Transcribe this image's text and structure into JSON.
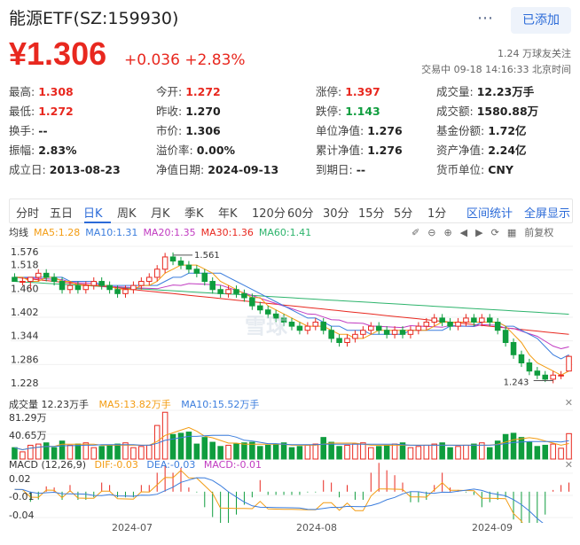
{
  "header": {
    "title": "能源ETF(SZ:159930)",
    "add_label": "已添加",
    "more_icon": "more-icon"
  },
  "quote": {
    "price": "¥1.306",
    "change": "+0.036 +2.83%",
    "followers": "1.24 万球友关注",
    "status": "交易中 09-18 14:16:33 北京时间"
  },
  "stats": [
    {
      "k": "最高:",
      "v": "1.308",
      "c": "red"
    },
    {
      "k": "今开:",
      "v": "1.272",
      "c": "red"
    },
    {
      "k": "涨停:",
      "v": "1.397",
      "c": "red"
    },
    {
      "k": "成交量:",
      "v": "12.23万手",
      "c": ""
    },
    {
      "k": "最低:",
      "v": "1.272",
      "c": "red"
    },
    {
      "k": "昨收:",
      "v": "1.270",
      "c": ""
    },
    {
      "k": "跌停:",
      "v": "1.143",
      "c": "green"
    },
    {
      "k": "成交额:",
      "v": "1580.88万",
      "c": ""
    },
    {
      "k": "换手:",
      "v": "--",
      "c": ""
    },
    {
      "k": "市价:",
      "v": "1.306",
      "c": ""
    },
    {
      "k": "单位净值:",
      "v": "1.276",
      "c": ""
    },
    {
      "k": "基金份额:",
      "v": "1.72亿",
      "c": ""
    },
    {
      "k": "振幅:",
      "v": "2.83%",
      "c": ""
    },
    {
      "k": "溢价率:",
      "v": "0.00%",
      "c": ""
    },
    {
      "k": "累计净值:",
      "v": "1.276",
      "c": ""
    },
    {
      "k": "资产净值:",
      "v": "2.24亿",
      "c": ""
    },
    {
      "k": "成立日:",
      "v": "2013-08-23",
      "c": ""
    },
    {
      "k": "净值日期:",
      "v": "2024-09-13",
      "c": ""
    },
    {
      "k": "到期日:",
      "v": "--",
      "c": ""
    },
    {
      "k": "货币单位:",
      "v": "CNY",
      "c": ""
    }
  ],
  "tabs": [
    "分时",
    "五日",
    "日K",
    "周K",
    "月K",
    "季K",
    "年K",
    "120分",
    "60分",
    "30分",
    "15分",
    "5分",
    "1分"
  ],
  "active_tab": "日K",
  "tabs_right": [
    "区间统计",
    "全屏显示"
  ],
  "ma_legend": [
    {
      "label": "均线",
      "color": "#333333"
    },
    {
      "label": "MA5:1.28",
      "color": "#f39c12"
    },
    {
      "label": "MA10:1.31",
      "color": "#3b7ddd"
    },
    {
      "label": "MA20:1.35",
      "color": "#c13bc1"
    },
    {
      "label": "MA30:1.36",
      "color": "#e8281f"
    },
    {
      "label": "MA60:1.41",
      "color": "#2db46c"
    }
  ],
  "adjust_label": "前复权",
  "price_axis": [
    "1.576",
    "1.518",
    "1.460",
    "1.402",
    "1.344",
    "1.286",
    "1.228"
  ],
  "annotations": {
    "high": "1.561",
    "low": "1.243"
  },
  "watermark": "雪球",
  "volume": {
    "title": "成交量 12.23万手",
    "ma5": "MA5:13.82万手",
    "ma10": "MA10:15.52万手",
    "axis_top": "81.29万",
    "axis_mid": "40.65万"
  },
  "macd": {
    "title": "MACD (12,26,9)",
    "dif": "DIF:-0.03",
    "dea": "DEA:-0.03",
    "macd": "MACD:-0.01",
    "axis": [
      "0.02",
      "-0.01",
      "-0.04"
    ]
  },
  "dates": [
    "2024-07",
    "2024-08",
    "2024-09"
  ],
  "colors": {
    "up": "#e8281f",
    "down": "#0f9d3e",
    "accent": "#2c6bd8"
  },
  "chart_data": {
    "type": "candlestick",
    "ylim": [
      1.228,
      1.576
    ],
    "ohlc": [
      [
        1.5,
        1.51,
        1.49,
        1.49
      ],
      [
        1.49,
        1.5,
        1.48,
        1.49
      ],
      [
        1.49,
        1.5,
        1.47,
        1.5
      ],
      [
        1.5,
        1.52,
        1.49,
        1.51
      ],
      [
        1.51,
        1.52,
        1.49,
        1.5
      ],
      [
        1.5,
        1.51,
        1.48,
        1.49
      ],
      [
        1.49,
        1.5,
        1.46,
        1.47
      ],
      [
        1.47,
        1.49,
        1.46,
        1.48
      ],
      [
        1.48,
        1.49,
        1.46,
        1.47
      ],
      [
        1.47,
        1.49,
        1.46,
        1.48
      ],
      [
        1.48,
        1.5,
        1.47,
        1.49
      ],
      [
        1.49,
        1.5,
        1.47,
        1.48
      ],
      [
        1.48,
        1.49,
        1.46,
        1.47
      ],
      [
        1.47,
        1.48,
        1.45,
        1.46
      ],
      [
        1.46,
        1.48,
        1.45,
        1.47
      ],
      [
        1.47,
        1.49,
        1.46,
        1.48
      ],
      [
        1.48,
        1.5,
        1.47,
        1.49
      ],
      [
        1.49,
        1.51,
        1.48,
        1.5
      ],
      [
        1.5,
        1.53,
        1.49,
        1.52
      ],
      [
        1.52,
        1.56,
        1.51,
        1.55
      ],
      [
        1.55,
        1.561,
        1.53,
        1.54
      ],
      [
        1.54,
        1.55,
        1.52,
        1.53
      ],
      [
        1.53,
        1.54,
        1.51,
        1.52
      ],
      [
        1.52,
        1.53,
        1.5,
        1.51
      ],
      [
        1.51,
        1.52,
        1.48,
        1.49
      ],
      [
        1.49,
        1.5,
        1.46,
        1.47
      ],
      [
        1.47,
        1.48,
        1.45,
        1.46
      ],
      [
        1.46,
        1.48,
        1.45,
        1.47
      ],
      [
        1.47,
        1.48,
        1.45,
        1.46
      ],
      [
        1.46,
        1.47,
        1.44,
        1.45
      ],
      [
        1.45,
        1.46,
        1.42,
        1.43
      ],
      [
        1.43,
        1.44,
        1.41,
        1.42
      ],
      [
        1.42,
        1.43,
        1.4,
        1.41
      ],
      [
        1.41,
        1.42,
        1.39,
        1.4
      ],
      [
        1.4,
        1.41,
        1.38,
        1.39
      ],
      [
        1.39,
        1.4,
        1.37,
        1.38
      ],
      [
        1.38,
        1.39,
        1.36,
        1.37
      ],
      [
        1.37,
        1.39,
        1.36,
        1.38
      ],
      [
        1.38,
        1.4,
        1.37,
        1.39
      ],
      [
        1.39,
        1.4,
        1.36,
        1.37
      ],
      [
        1.37,
        1.38,
        1.34,
        1.35
      ],
      [
        1.35,
        1.36,
        1.33,
        1.34
      ],
      [
        1.34,
        1.36,
        1.33,
        1.35
      ],
      [
        1.35,
        1.37,
        1.34,
        1.36
      ],
      [
        1.36,
        1.38,
        1.35,
        1.37
      ],
      [
        1.37,
        1.39,
        1.36,
        1.38
      ],
      [
        1.38,
        1.39,
        1.36,
        1.37
      ],
      [
        1.37,
        1.38,
        1.35,
        1.36
      ],
      [
        1.36,
        1.38,
        1.35,
        1.37
      ],
      [
        1.37,
        1.38,
        1.35,
        1.36
      ],
      [
        1.36,
        1.38,
        1.35,
        1.37
      ],
      [
        1.37,
        1.39,
        1.36,
        1.38
      ],
      [
        1.38,
        1.4,
        1.37,
        1.39
      ],
      [
        1.39,
        1.41,
        1.38,
        1.4
      ],
      [
        1.4,
        1.41,
        1.38,
        1.39
      ],
      [
        1.39,
        1.4,
        1.37,
        1.38
      ],
      [
        1.38,
        1.4,
        1.37,
        1.39
      ],
      [
        1.39,
        1.41,
        1.38,
        1.4
      ],
      [
        1.4,
        1.41,
        1.38,
        1.39
      ],
      [
        1.39,
        1.41,
        1.38,
        1.4
      ],
      [
        1.4,
        1.41,
        1.38,
        1.39
      ],
      [
        1.39,
        1.4,
        1.36,
        1.37
      ],
      [
        1.37,
        1.38,
        1.33,
        1.34
      ],
      [
        1.34,
        1.35,
        1.3,
        1.31
      ],
      [
        1.31,
        1.32,
        1.28,
        1.29
      ],
      [
        1.29,
        1.3,
        1.26,
        1.27
      ],
      [
        1.27,
        1.28,
        1.25,
        1.26
      ],
      [
        1.26,
        1.27,
        1.243,
        1.25
      ],
      [
        1.25,
        1.27,
        1.24,
        1.26
      ],
      [
        1.26,
        1.27,
        1.25,
        1.26
      ],
      [
        1.27,
        1.308,
        1.272,
        1.306
      ]
    ],
    "ma5": [
      1.5,
      1.5,
      1.49,
      1.49,
      1.5,
      1.5,
      1.49,
      1.49,
      1.48,
      1.48,
      1.48,
      1.48,
      1.48,
      1.47,
      1.47,
      1.47,
      1.48,
      1.48,
      1.49,
      1.51,
      1.52,
      1.53,
      1.53,
      1.53,
      1.52,
      1.51,
      1.49,
      1.48,
      1.47,
      1.46,
      1.45,
      1.45,
      1.43,
      1.42,
      1.41,
      1.4,
      1.39,
      1.38,
      1.38,
      1.38,
      1.37,
      1.36,
      1.36,
      1.35,
      1.35,
      1.36,
      1.37,
      1.37,
      1.37,
      1.37,
      1.37,
      1.37,
      1.37,
      1.38,
      1.39,
      1.39,
      1.39,
      1.39,
      1.39,
      1.39,
      1.39,
      1.39,
      1.38,
      1.36,
      1.34,
      1.31,
      1.29,
      1.28,
      1.27,
      1.26,
      1.27
    ],
    "ma10": [
      1.5,
      1.5,
      1.5,
      1.5,
      1.5,
      1.5,
      1.5,
      1.49,
      1.49,
      1.49,
      1.49,
      1.48,
      1.48,
      1.48,
      1.48,
      1.48,
      1.48,
      1.48,
      1.48,
      1.49,
      1.5,
      1.5,
      1.51,
      1.51,
      1.51,
      1.51,
      1.51,
      1.5,
      1.49,
      1.48,
      1.47,
      1.46,
      1.45,
      1.44,
      1.43,
      1.42,
      1.41,
      1.4,
      1.4,
      1.39,
      1.38,
      1.38,
      1.37,
      1.37,
      1.37,
      1.36,
      1.36,
      1.36,
      1.36,
      1.36,
      1.37,
      1.37,
      1.37,
      1.37,
      1.37,
      1.38,
      1.38,
      1.38,
      1.38,
      1.39,
      1.39,
      1.39,
      1.38,
      1.38,
      1.37,
      1.36,
      1.35,
      1.33,
      1.31,
      1.3,
      1.31
    ]
  }
}
